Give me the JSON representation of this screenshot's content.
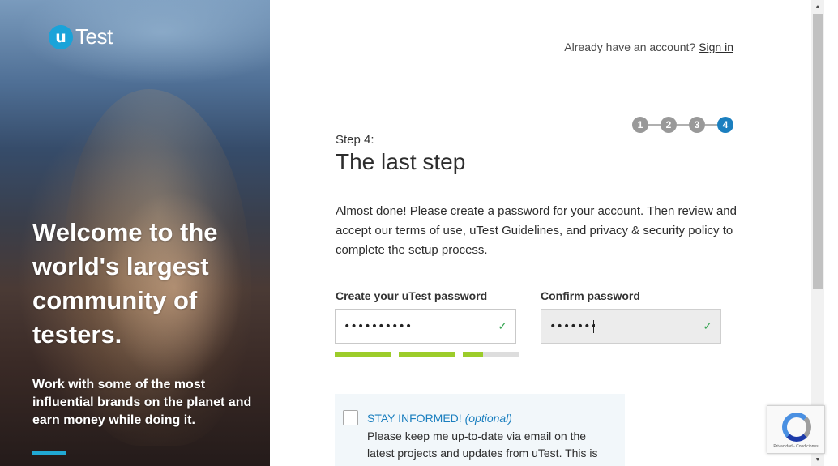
{
  "hero": {
    "logo_letter": "u",
    "logo_text": "Test",
    "title": "Welcome to the world's largest community of testers.",
    "subtitle": "Work with some of the most influential brands on the planet and earn money while doing it."
  },
  "header": {
    "already_text": "Already have an account?",
    "signin_label": "Sign in"
  },
  "steps": [
    "1",
    "2",
    "3",
    "4"
  ],
  "active_step": "4",
  "form": {
    "step_label": "Step 4:",
    "step_title": "The last step",
    "description": "Almost done! Please create a password for your account. Then review and accept our terms of use, uTest Guidelines, and privacy & security policy to complete the setup process.",
    "password_label": "Create your uTest password",
    "password_value": "••••••••••",
    "confirm_label": "Confirm password",
    "confirm_value": "••••••••••",
    "password_valid_icon": "check-icon",
    "confirm_valid_icon": "check-icon",
    "strength_fill": [
      1.0,
      1.0,
      0.35
    ]
  },
  "optin": {
    "title": "STAY INFORMED!",
    "title_optional": "(optional)",
    "text": "Please keep me up-to-date via email on the latest projects and updates from uTest. This is"
  },
  "recaptcha": {
    "footer": "Privacidad - Condiciones"
  },
  "colors": {
    "accent": "#1b7fbf",
    "logo_blue": "#1aa3d9",
    "strength_green": "#9ccc2a",
    "check_green": "#3aa655"
  }
}
